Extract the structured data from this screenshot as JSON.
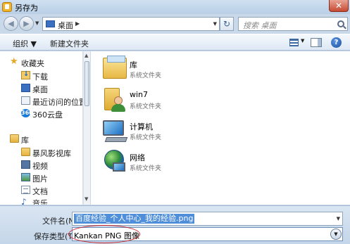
{
  "window": {
    "title": "另存为",
    "close_glyph": "✕"
  },
  "navbar": {
    "back_glyph": "◀",
    "forward_glyph": "▶",
    "dropdown_glyph": "▼",
    "address": "桌面",
    "address_sep": "▶",
    "refresh_glyph": "↻",
    "search_placeholder": "搜索 桌面"
  },
  "toolbar": {
    "organize": "组织 ▼",
    "new_folder": "新建文件夹",
    "view_dropdown": "▼",
    "help": "?"
  },
  "sidebar": {
    "favorites": {
      "label": "收藏夹",
      "items": [
        "下载",
        "桌面",
        "最近访问的位置",
        "360云盘"
      ]
    },
    "libraries": {
      "label": "库",
      "items": [
        "暴风影视库",
        "视频",
        "图片",
        "文档",
        "音乐"
      ]
    },
    "cloud_icon_text": "360",
    "scroll_up": "▲",
    "scroll_down": "▼"
  },
  "files": [
    {
      "name": "库",
      "type": "系统文件夹",
      "icon": "library-icon"
    },
    {
      "name": "win7",
      "type": "系统文件夹",
      "icon": "user-folder-icon"
    },
    {
      "name": "计算机",
      "type": "系统文件夹",
      "icon": "computer-icon"
    },
    {
      "name": "网络",
      "type": "系统文件夹",
      "icon": "network-icon"
    }
  ],
  "form": {
    "filename_label": "文件名(N):",
    "filename_value": "百度经验_个人中心_我的经验.png",
    "type_label": "保存类型(T):",
    "type_value": "Kankan PNG 图像",
    "dropdown_glyph": "▼"
  },
  "colors": {
    "selection": "#4f8fd9",
    "annotation": "#c8232a",
    "chrome": "#c9d9ea"
  }
}
